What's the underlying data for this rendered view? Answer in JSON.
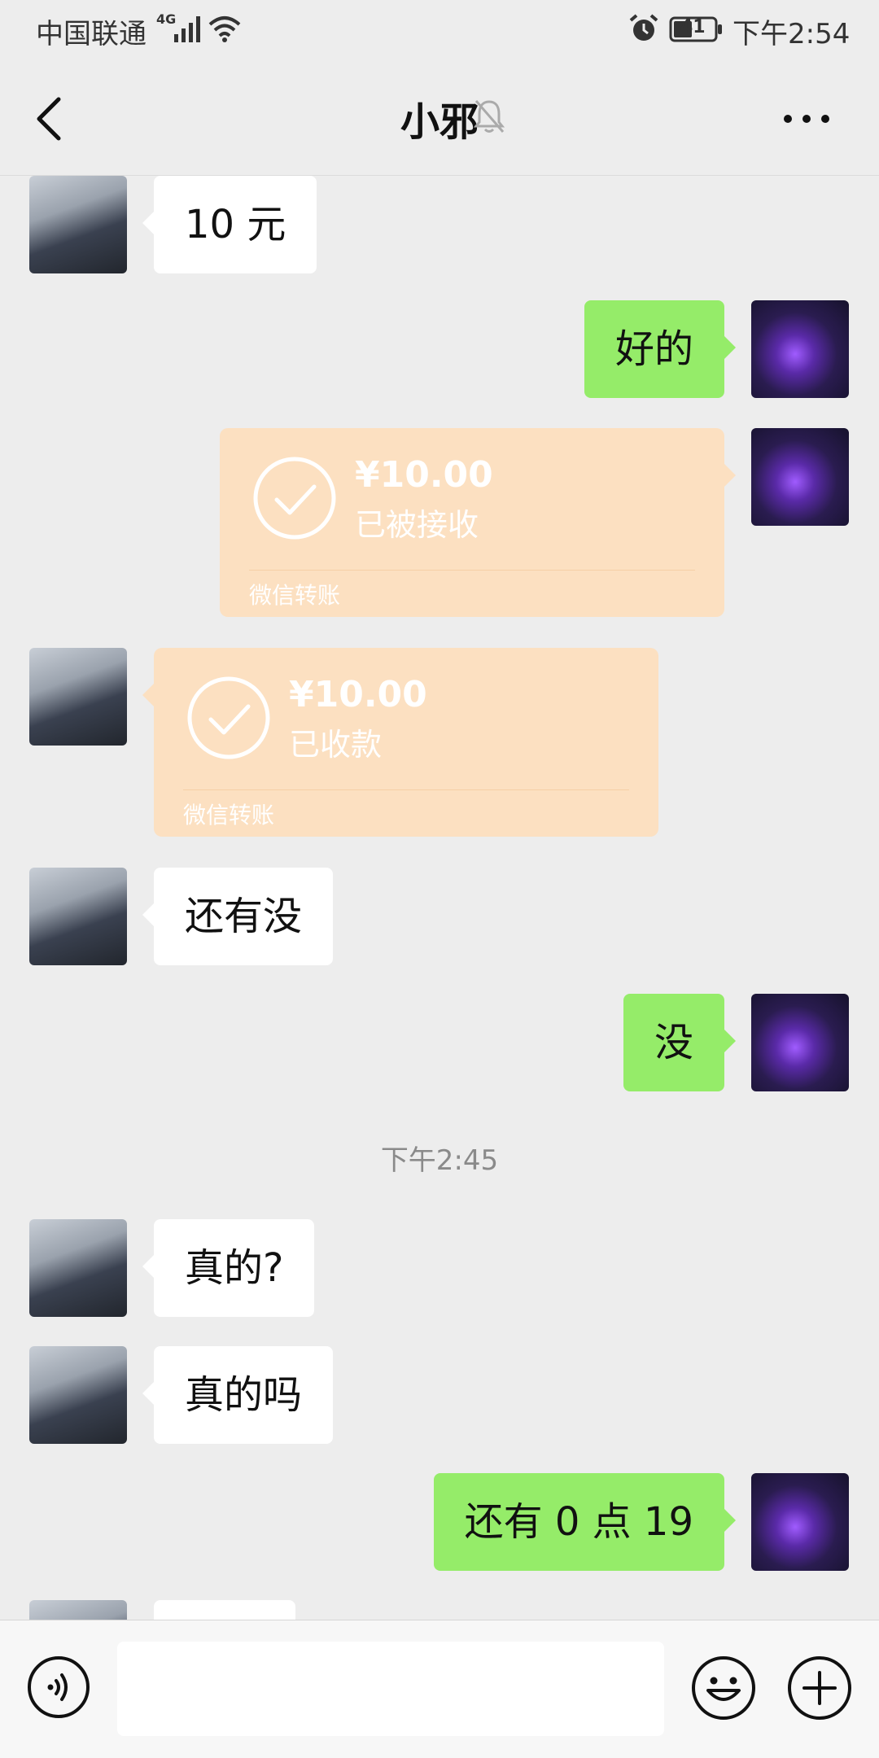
{
  "status_bar": {
    "carrier": "中国联通",
    "network": "4G",
    "battery": "41",
    "time": "下午2:54"
  },
  "header": {
    "title": "小邪"
  },
  "messages": {
    "m1": {
      "text": "10 元"
    },
    "m2": {
      "text": "好的"
    },
    "m3": {
      "amount": "¥10.00",
      "status": "已被接收",
      "footer": "微信转账"
    },
    "m4": {
      "amount": "¥10.00",
      "status": "已收款",
      "footer": "微信转账"
    },
    "m5": {
      "text": "还有没"
    },
    "m6": {
      "text": "没"
    },
    "ts1": {
      "text": "下午2:45"
    },
    "m7": {
      "text": "真的?"
    },
    "m8": {
      "text": "真的吗"
    },
    "m9": {
      "text": "还有 0 点 19"
    }
  },
  "colors": {
    "sent_bubble": "#95ec69",
    "received_bubble": "#ffffff",
    "transfer_card": "#fce0c1",
    "background": "#ededed"
  }
}
